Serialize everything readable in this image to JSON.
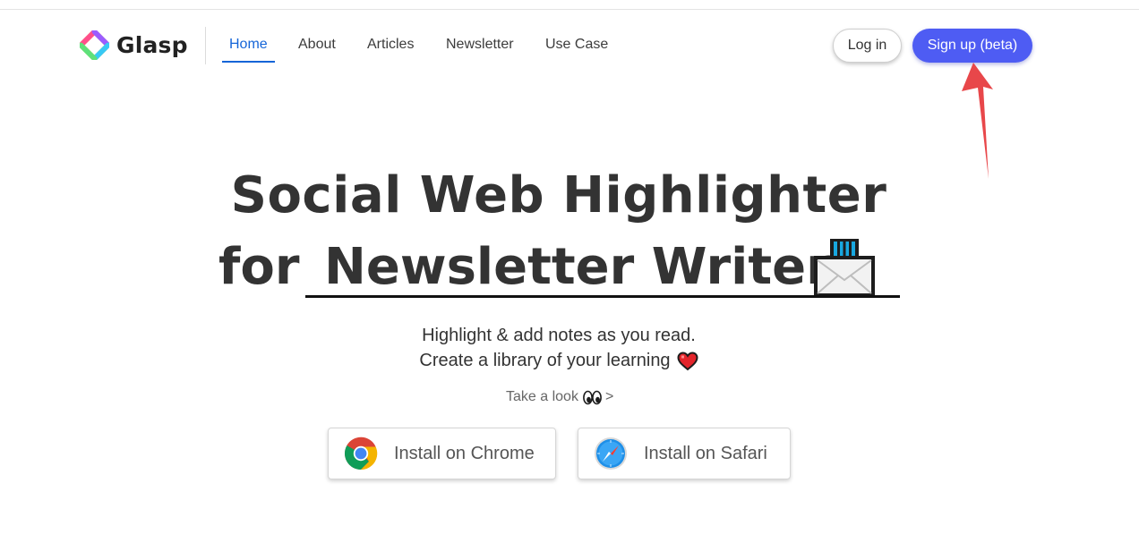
{
  "brand": {
    "name": "Glasp",
    "logo_icon": "glasp-diamond-logo",
    "colors": {
      "primary": "#4e5cf3",
      "nav_active": "#1565d8",
      "annotation_arrow": "#e8474a"
    }
  },
  "nav": {
    "items": [
      {
        "label": "Home",
        "active": true
      },
      {
        "label": "About",
        "active": false
      },
      {
        "label": "Articles",
        "active": false
      },
      {
        "label": "Newsletter",
        "active": false
      },
      {
        "label": "Use Case",
        "active": false
      }
    ],
    "login_label": "Log in",
    "signup_label": "Sign up (beta)"
  },
  "hero": {
    "line1": "Social Web Highlighter",
    "for_word": "for",
    "rotating_text": "Newsletter Writers",
    "rotating_icon": "envelope-icon",
    "subtitle_line1": "Highlight & add notes as you read.",
    "subtitle_line2": "Create a library of your learning",
    "subtitle_icon": "heart-icon",
    "take_look_label": "Take a look",
    "take_look_icon": "eyes-icon",
    "take_look_chevron": ">"
  },
  "install": {
    "chrome_label": "Install on Chrome",
    "chrome_icon": "chrome-icon",
    "safari_label": "Install on Safari",
    "safari_icon": "safari-compass-icon"
  },
  "annotation": {
    "icon": "red-arrow-pointing-up"
  }
}
